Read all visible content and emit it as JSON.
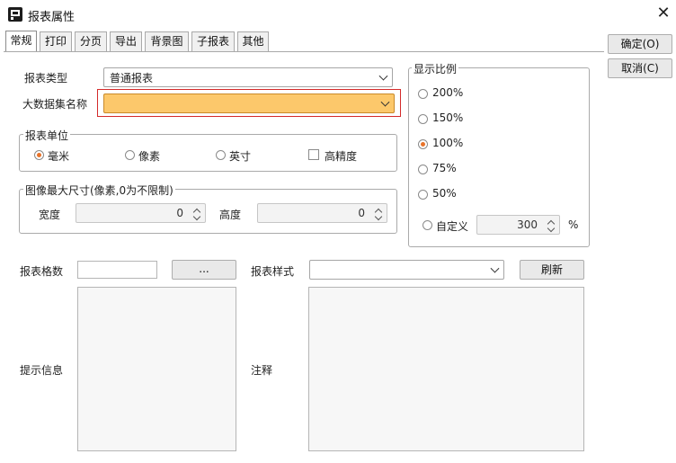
{
  "window": {
    "title": "报表属性",
    "close_glyph": "✕"
  },
  "tabs": [
    "常规",
    "打印",
    "分页",
    "导出",
    "背景图",
    "子报表",
    "其他"
  ],
  "buttons": {
    "ok": "确定(O)",
    "cancel": "取消(C)",
    "ellipsis": "...",
    "refresh": "刷新"
  },
  "general": {
    "report_type_label": "报表类型",
    "report_type_value": "普通报表",
    "big_dataset_label": "大数据集名称",
    "big_dataset_value": "",
    "unit_group": "报表单位",
    "units": [
      "毫米",
      "像素",
      "英寸"
    ],
    "selected_unit": "毫米",
    "high_precision_label": "高精度",
    "image_group": "图像最大尺寸(像素,0为不限制)",
    "width_label": "宽度",
    "width_value": "0",
    "height_label": "高度",
    "height_value": "0",
    "grid_label": "报表格数",
    "grid_value": "",
    "style_label": "报表样式",
    "style_value": "",
    "hint_label": "提示信息",
    "note_label": "注释"
  },
  "scale": {
    "group": "显示比例",
    "options": [
      "200%",
      "150%",
      "100%",
      "75%",
      "50%"
    ],
    "selected": "100%",
    "custom_label": "自定义",
    "custom_value": "300",
    "percent": "%"
  },
  "colors": {
    "highlight_field": "#fcc86b",
    "highlight_border": "#d42a2a",
    "radio_selected": "#e8732a"
  }
}
